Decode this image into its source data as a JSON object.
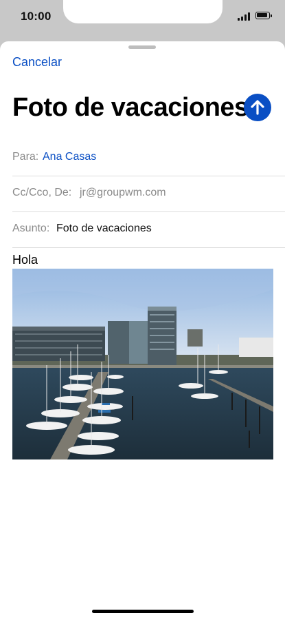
{
  "status": {
    "time": "10:00"
  },
  "compose": {
    "cancel_label": "Cancelar",
    "title": "Foto de vacaciones",
    "send_icon": "arrow-up-icon",
    "accent": "#0a4fc4",
    "fields": {
      "to_label": "Para:",
      "to_value": "Ana Casas",
      "cc_label": "Cc/Cco, De:",
      "cc_value": "jr@groupwm.com",
      "subject_label": "Asunto:",
      "subject_value": "Foto de vacaciones"
    },
    "body_text": "Hola",
    "attachment": "harbor-photo"
  }
}
